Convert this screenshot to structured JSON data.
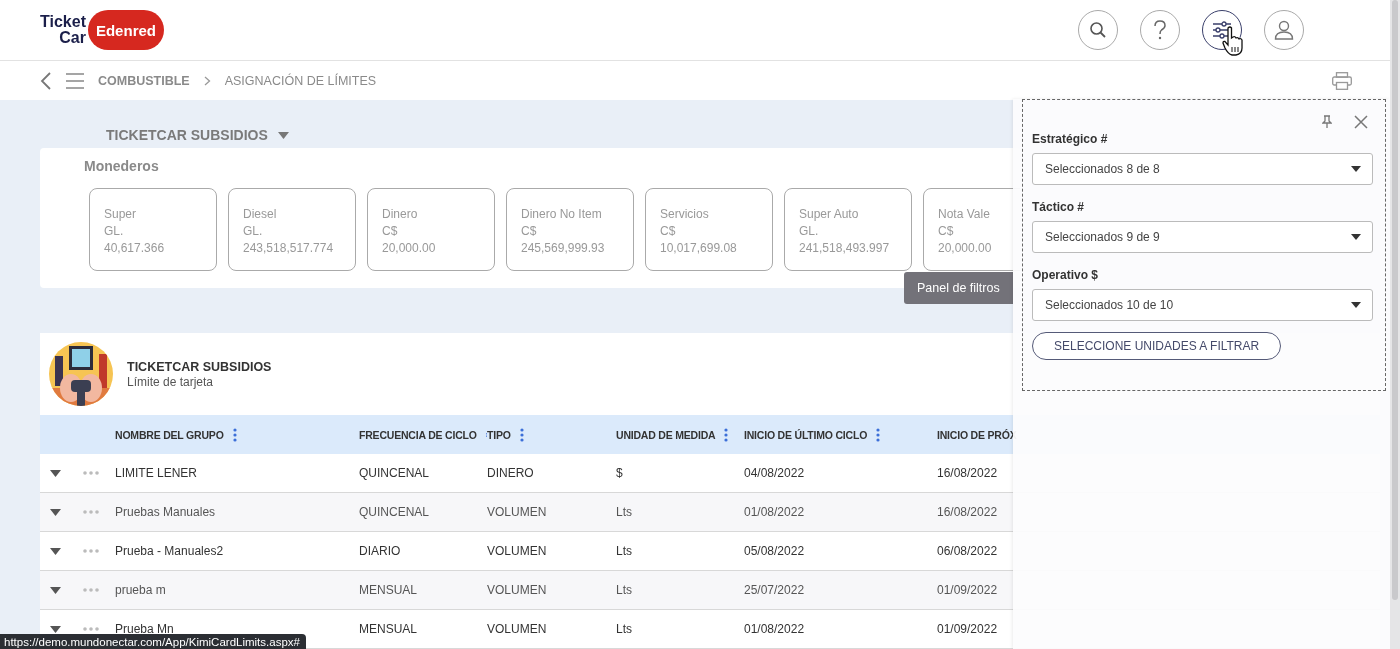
{
  "header": {
    "logo": {
      "line1": "Ticket",
      "line2": "Car",
      "brand": "Edenred"
    },
    "actions": [
      {
        "kind": "search",
        "selected": false
      },
      {
        "kind": "help",
        "selected": false
      },
      {
        "kind": "filters",
        "selected": true
      },
      {
        "kind": "user",
        "selected": false
      }
    ]
  },
  "breadcrumb": [
    "COMBUSTIBLE",
    "ASIGNACIÓN DE LÍMITES"
  ],
  "company_selector": "TICKETCAR SUBSIDIOS",
  "wallets": {
    "title": "Monederos",
    "items": [
      {
        "name": "Super",
        "unit": "GL.",
        "amount": "40,617.366"
      },
      {
        "name": "Diesel",
        "unit": "GL.",
        "amount": "243,518,517.774"
      },
      {
        "name": "Dinero",
        "unit": "C$",
        "amount": "20,000.00"
      },
      {
        "name": "Dinero No Item",
        "unit": "C$",
        "amount": "245,569,999.93"
      },
      {
        "name": "Servicios",
        "unit": "C$",
        "amount": "10,017,699.08"
      },
      {
        "name": "Super Auto",
        "unit": "GL.",
        "amount": "241,518,493.997"
      },
      {
        "name": "Nota Vale",
        "unit": "C$",
        "amount": "20,000.00"
      }
    ]
  },
  "tooltip": "Panel de filtros",
  "group_card": {
    "title": "TICKETCAR SUBSIDIOS",
    "subtitle": "Límite de tarjeta"
  },
  "table": {
    "columns": [
      "NOMBRE DEL GRUPO",
      "FRECUENCIA DE CICLO",
      "TIPO",
      "UNIDAD DE MEDIDA",
      "INICIO DE ÚLTIMO CICLO",
      "INICIO DE PRÓX"
    ],
    "rows": [
      [
        "LIMITE LENER",
        "QUINCENAL",
        "DINERO",
        "$",
        "04/08/2022",
        "16/08/2022"
      ],
      [
        "Pruebas Manuales",
        "QUINCENAL",
        "VOLUMEN",
        "Lts",
        "01/08/2022",
        "16/08/2022"
      ],
      [
        "Prueba - Manuales2",
        "DIARIO",
        "VOLUMEN",
        "Lts",
        "05/08/2022",
        "06/08/2022"
      ],
      [
        "prueba m",
        "MENSUAL",
        "VOLUMEN",
        "Lts",
        "25/07/2022",
        "01/09/2022"
      ],
      [
        "Prueba Mn",
        "MENSUAL",
        "VOLUMEN",
        "Lts",
        "01/08/2022",
        "01/09/2022"
      ]
    ]
  },
  "filter_panel": {
    "fields": [
      {
        "label": "Estratégico #",
        "value": "Seleccionados 8 de 8"
      },
      {
        "label": "Táctico #",
        "value": "Seleccionados 9 de 9"
      },
      {
        "label": "Operativo $",
        "value": "Seleccionados 10 de 10"
      }
    ],
    "button": "SELECCIONE UNIDADES A FILTRAR"
  },
  "status_url": "https://demo.mundonectar.com/App/KimiCardLimits.aspx#"
}
